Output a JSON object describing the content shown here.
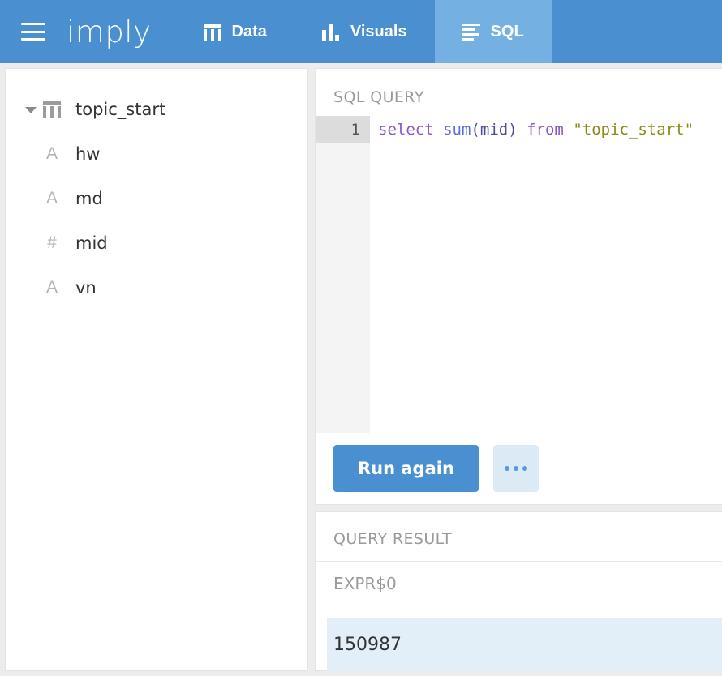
{
  "header": {
    "menu_icon": "hamburger-icon",
    "logo": "imply",
    "tabs": [
      {
        "label": "Data",
        "icon": "table-icon",
        "active": false
      },
      {
        "label": "Visuals",
        "icon": "bar-chart-icon",
        "active": false
      },
      {
        "label": "SQL",
        "icon": "lines-icon",
        "active": true
      }
    ]
  },
  "sidebar": {
    "table": {
      "label": "topic_start",
      "icon": "table-icon",
      "expanded": true
    },
    "columns": [
      {
        "label": "hw",
        "icon": "string-type-icon",
        "glyph": "A"
      },
      {
        "label": "md",
        "icon": "string-type-icon",
        "glyph": "A"
      },
      {
        "label": "mid",
        "icon": "number-type-icon",
        "glyph": "#"
      },
      {
        "label": "vn",
        "icon": "string-type-icon",
        "glyph": "A"
      }
    ]
  },
  "query_panel": {
    "title": "SQL QUERY",
    "line_number": "1",
    "query_text": "select sum(mid) from \"topic_start\"",
    "tokens": {
      "kw_select": "select",
      "fn_sum": "sum",
      "paren_open": "(",
      "ident_mid": "mid",
      "paren_close": ")",
      "kw_from": "from",
      "string_table": "\"topic_start\""
    },
    "run_button": "Run again",
    "more_button": "more-options"
  },
  "result_panel": {
    "title": "QUERY RESULT",
    "columns": [
      "EXPR$0"
    ],
    "rows": [
      [
        "150987"
      ]
    ]
  },
  "colors": {
    "header_blue": "#4a90d0",
    "active_tab_blue": "#74b0e2",
    "button_blue": "#4a90d0",
    "result_row_blue": "#e2eef8",
    "keyword_purple": "#8a56c4",
    "string_olive": "#8a8a16"
  }
}
